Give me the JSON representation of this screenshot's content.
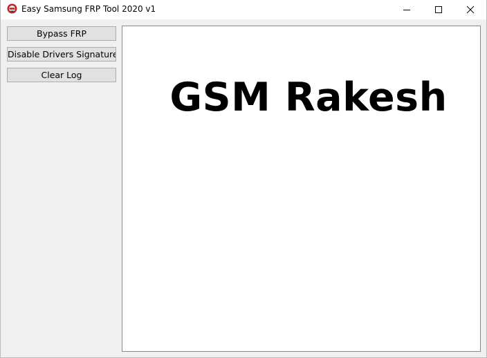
{
  "window": {
    "title": "Easy Samsung FRP Tool 2020 v1",
    "app_icon": "samsung-frp-app-icon",
    "caption_buttons": [
      "minimize-icon",
      "maximize-icon",
      "close-icon"
    ]
  },
  "sidebar": {
    "buttons": [
      {
        "label": "Bypass FRP"
      },
      {
        "label": "Disable Drivers Signatures"
      },
      {
        "label": "Clear Log"
      }
    ]
  },
  "log": {
    "heading": "GSM Rakesh"
  },
  "colors": {
    "window_bg": "#f0f0f0",
    "titlebar_bg": "#ffffff",
    "button_bg": "#e1e1e1",
    "button_border": "#adadad",
    "panel_bg": "#ffffff",
    "panel_border": "#828790",
    "text": "#000000"
  }
}
